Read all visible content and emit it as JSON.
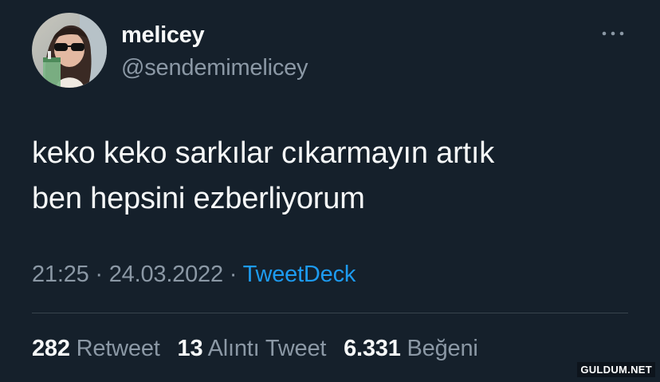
{
  "author": {
    "display_name": "melicey",
    "handle": "@sendemimelicey"
  },
  "tweet": {
    "line1": "keko keko sarkılar cıkarmayın artık",
    "line2": "ben hepsini ezberliyorum"
  },
  "meta": {
    "time": "21:25",
    "separator1": " · ",
    "date": "24.03.2022",
    "separator2": " · ",
    "source": "TweetDeck"
  },
  "stats": {
    "retweets_count": "282",
    "retweets_label": "Retweet",
    "quotes_count": "13",
    "quotes_label": "Alıntı Tweet",
    "likes_count": "6.331",
    "likes_label": "Beğeni"
  },
  "watermark": "GULDUM.NET",
  "icons": {
    "more": "more-options-icon",
    "avatar": "avatar"
  },
  "colors": {
    "background": "#15202b",
    "primary_text": "#f7f9f9",
    "secondary_text": "#8b98a5",
    "link": "#1d9bf0",
    "divider": "#38444d"
  }
}
